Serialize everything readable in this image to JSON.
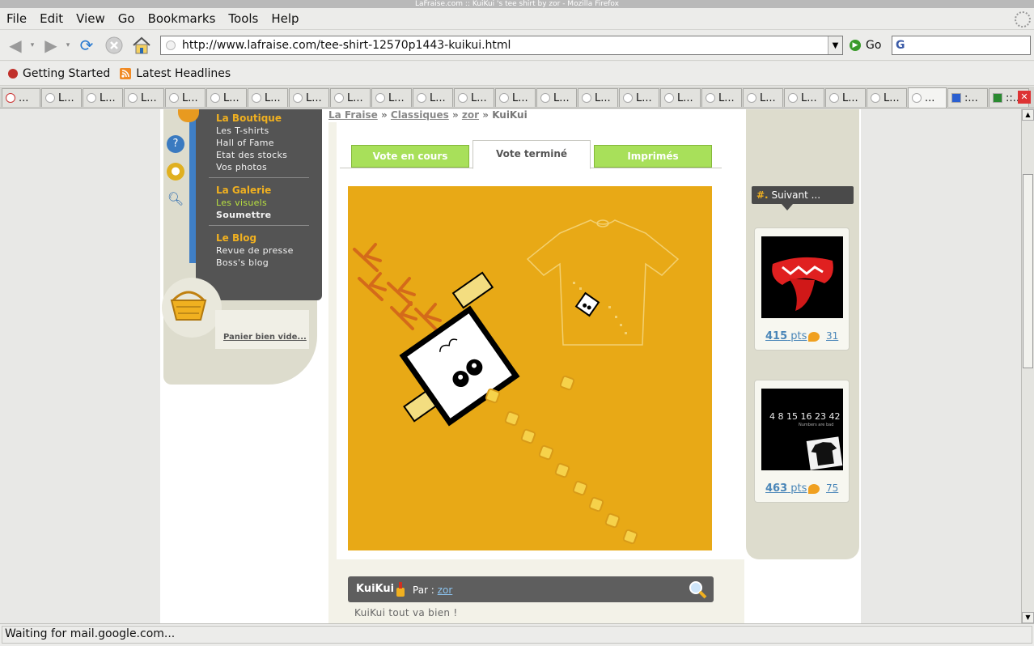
{
  "window": {
    "title": "LaFraise.com :: KuiKui 's tee shirt by zor - Mozilla Firefox"
  },
  "menu": [
    "File",
    "Edit",
    "View",
    "Go",
    "Bookmarks",
    "Tools",
    "Help"
  ],
  "toolbar": {
    "url": "http://www.lafraise.com/tee-shirt-12570p1443-kuikui.html",
    "go_label": "Go",
    "search_value": ""
  },
  "bookmarks": [
    "Getting Started",
    "Latest Headlines"
  ],
  "tabs": [
    "...",
    "L...",
    "L...",
    "L...",
    "L...",
    "L...",
    "L...",
    "L...",
    "L...",
    "L...",
    "L...",
    "L...",
    "L...",
    "L...",
    "L...",
    "L...",
    "L...",
    "L...",
    "L...",
    "L...",
    "L...",
    "L...",
    "...",
    ":...",
    "::..."
  ],
  "status": "Waiting for mail.google.com...",
  "sidebar": {
    "sections": [
      {
        "heading": "La Boutique",
        "links": [
          "Les T-shirts",
          "Hall of Fame",
          "Etat des stocks",
          "Vos photos"
        ]
      },
      {
        "heading": "La Galerie",
        "links": [
          "Les visuels",
          "Soumettre"
        ]
      },
      {
        "heading": "Le Blog",
        "links": [
          "Revue de presse",
          "Boss's blog"
        ]
      }
    ],
    "cart": "Panier bien vide..."
  },
  "breadcrumb": {
    "items": [
      "La Fraise",
      "Classiques",
      "zor"
    ],
    "current": "KuiKui",
    "sep": "»"
  },
  "vote_tabs": [
    "Vote en cours",
    "Vote terminé",
    "Imprimés"
  ],
  "suivant": {
    "hash": "#.",
    "label": "Suivant ..."
  },
  "cards": [
    {
      "pts": "415",
      "unit": "pts",
      "comments": "31"
    },
    {
      "pts": "463",
      "unit": "pts",
      "comments": "75",
      "image_text": "4 8 15 16 23 42",
      "image_sub": "Numbers are bad"
    }
  ],
  "design": {
    "title": "KuiKui",
    "par_label": "Par :",
    "author": "zor",
    "description": "KuiKui tout va bien !"
  },
  "colors": {
    "accent_orange": "#e8a916",
    "tab_green": "#a8e05a",
    "link_blue": "#4a86b8"
  }
}
